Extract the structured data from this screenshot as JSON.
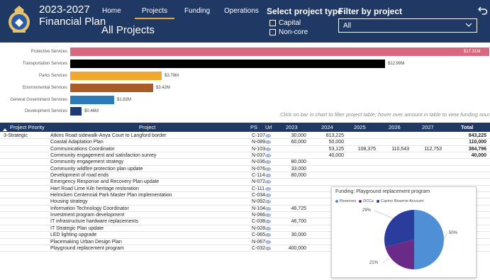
{
  "header": {
    "years": "2023-2027",
    "title": "Financial Plan",
    "nav": [
      "Home",
      "Projects",
      "Funding",
      "Operations"
    ],
    "active_nav": "Projects",
    "page_heading": "All Projects",
    "project_type_title": "Select project type",
    "project_type_options": [
      "Capital",
      "Non-core"
    ],
    "filter_title": "Filter by project",
    "filter_value": "All",
    "icons": {
      "logo": "crest-logo-icon",
      "back": "back-arrow-icon",
      "dropdown": "chevron-down-icon"
    },
    "colors": {
      "background": "#1f3864",
      "accent": "#f2a81d"
    }
  },
  "chart_data": {
    "type": "bar",
    "orientation": "horizontal",
    "categories": [
      "Protective Services",
      "Transportation Services",
      "Parks Services",
      "Environmental Services",
      "General Government Services",
      "Development Services"
    ],
    "values": [
      17.31,
      12.99,
      3.78,
      3.42,
      1.82,
      0.46
    ],
    "value_labels": [
      "$17.31M",
      "$12.99M",
      "$3.78M",
      "$3.42M",
      "$1.82M",
      "$0.46M"
    ],
    "colors": [
      "#d9687e",
      "#000000",
      "#f2a82d",
      "#a95c26",
      "#2b7bba",
      "#1f3876"
    ],
    "hint": "Click on bar in chart to filter project table; hover over amount in table to view funding source(s)"
  },
  "table": {
    "columns": [
      "Project Priority",
      "Project",
      "PS",
      "Url",
      "2023",
      "2024",
      "2025",
      "2026",
      "2027",
      "Total"
    ],
    "priority": "3-Strategic",
    "url_icon": "link-icon",
    "rows": [
      {
        "project": "Atkins Road sidewalk-Anya Court to Langford border",
        "ps": "C-107",
        "y2023": "30,000",
        "y2024": "813,225",
        "y2025": "",
        "y2026": "",
        "y2027": "",
        "total": "843,225"
      },
      {
        "project": "Coastal Adaptation Plan",
        "ps": "N-089",
        "y2023": "60,000",
        "y2024": "50,000",
        "y2025": "",
        "y2026": "",
        "y2027": "",
        "total": "110,000"
      },
      {
        "project": "Communications Coordinator",
        "ps": "N-103",
        "y2023": "",
        "y2024": "53,125",
        "y2025": "108,375",
        "y2026": "110,543",
        "y2027": "112,753",
        "total": "384,796"
      },
      {
        "project": "Community engagement and satisfaction survey",
        "ps": "N-037",
        "y2023": "",
        "y2024": "40,000",
        "y2025": "",
        "y2026": "",
        "y2027": "",
        "total": "40,000"
      },
      {
        "project": "Community engagement strategy",
        "ps": "N-036",
        "y2023": "80,000",
        "y2024": "",
        "y2025": "",
        "y2026": "",
        "y2027": "",
        "total": ""
      },
      {
        "project": "Community wildfire protection plan update",
        "ps": "N-076",
        "y2023": "33,000",
        "y2024": "",
        "y2025": "",
        "y2026": "",
        "y2027": "",
        "total": ""
      },
      {
        "project": "Development of road ends",
        "ps": "C-114",
        "y2023": "80,000",
        "y2024": "",
        "y2025": "",
        "y2026": "",
        "y2027": "",
        "total": ""
      },
      {
        "project": "Emergency Response and Recovery Plan update",
        "ps": "N-072",
        "y2023": "",
        "y2024": "",
        "y2025": "",
        "y2026": "",
        "y2027": "",
        "total": ""
      },
      {
        "project": "Hart Road Lime Kiln heritage restoration",
        "ps": "C-111",
        "y2023": "",
        "y2024": "",
        "y2025": "",
        "y2026": "",
        "y2027": "",
        "total": ""
      },
      {
        "project": "Helmcken Centennial Park Master Plan implementation",
        "ps": "C-034",
        "y2023": "",
        "y2024": "",
        "y2025": "",
        "y2026": "",
        "y2027": "",
        "total": ""
      },
      {
        "project": "Housing strategy",
        "ps": "N-092",
        "y2023": "",
        "y2024": "",
        "y2025": "",
        "y2026": "",
        "y2027": "",
        "total": ""
      },
      {
        "project": "Information Technology Coordinator",
        "ps": "N-104",
        "y2023": "46,725",
        "y2024": "",
        "y2025": "",
        "y2026": "",
        "y2027": "",
        "total": ""
      },
      {
        "project": "Investment program development",
        "ps": "N-066",
        "y2023": "",
        "y2024": "",
        "y2025": "",
        "y2026": "",
        "y2027": "",
        "total": ""
      },
      {
        "project": "IT infrastructure hardware replacements",
        "ps": "C-038",
        "y2023": "46,700",
        "y2024": "",
        "y2025": "",
        "y2026": "",
        "y2027": "",
        "total": ""
      },
      {
        "project": "IT Strategic Plan update",
        "ps": "N-028",
        "y2023": "",
        "y2024": "",
        "y2025": "",
        "y2026": "",
        "y2027": "",
        "total": ""
      },
      {
        "project": "LED lighting upgrade",
        "ps": "C-065",
        "y2023": "30,000",
        "y2024": "",
        "y2025": "",
        "y2026": "",
        "y2027": "",
        "total": ""
      },
      {
        "project": "Placemaking Urban Design Plan",
        "ps": "N-067",
        "y2023": "",
        "y2024": "",
        "y2025": "",
        "y2026": "",
        "y2027": "",
        "total": ""
      },
      {
        "project": "Playground replacement program",
        "ps": "C-032",
        "y2023": "400,000",
        "y2024": "",
        "y2025": "",
        "y2026": "",
        "y2027": "",
        "total": ""
      }
    ]
  },
  "popup": {
    "title": "Funding: Playground replacement program",
    "legend": [
      "Reserves",
      "DCCs",
      "Casino Reserve Account"
    ],
    "colors": [
      "#4f8fd6",
      "#6a2a87",
      "#2a3d9c"
    ],
    "slice_percents": [
      50,
      21,
      29
    ],
    "slice_labels": [
      "50%",
      "21%",
      "29%"
    ]
  }
}
